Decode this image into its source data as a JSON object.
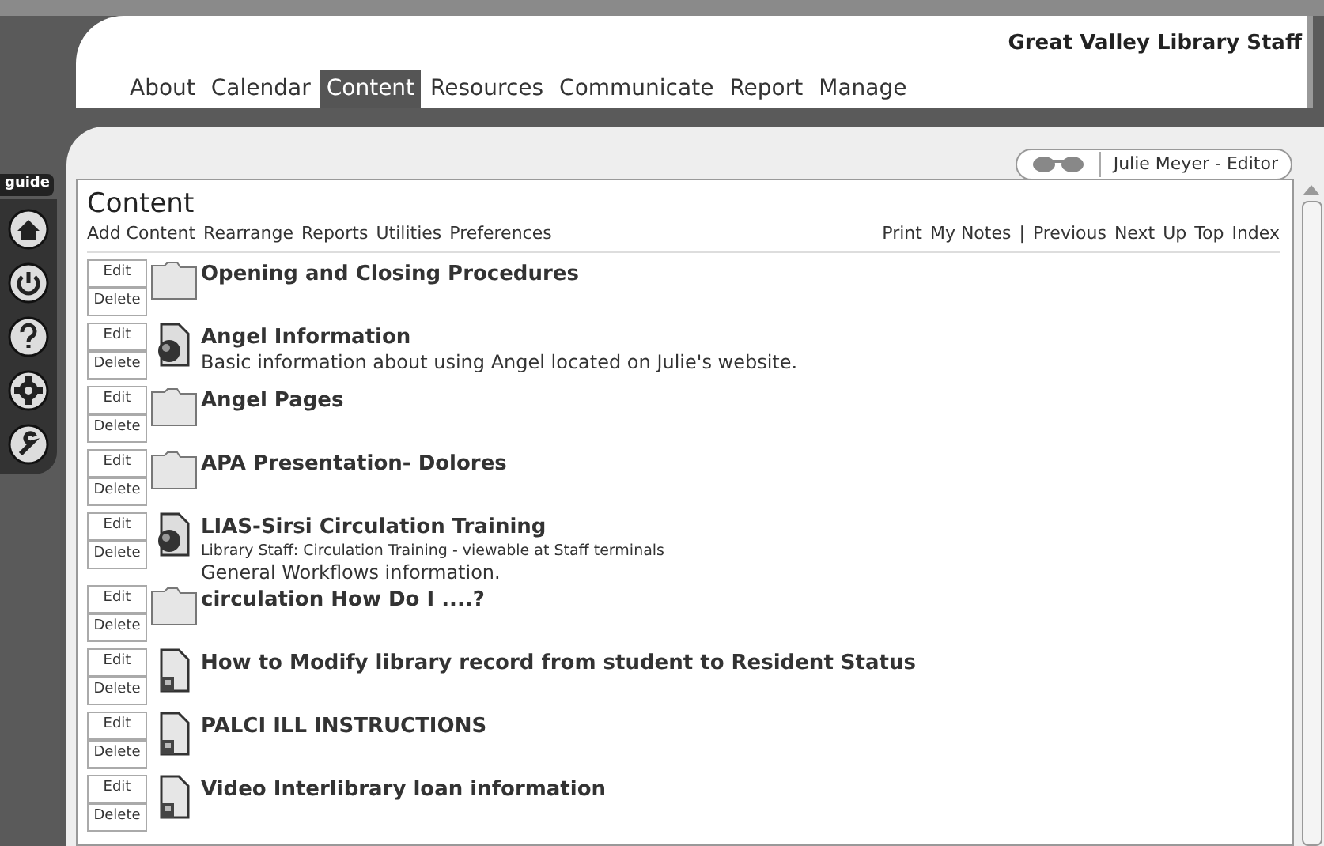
{
  "site_title": "Great Valley Library Staff",
  "tabs": [
    {
      "label": "About",
      "selected": false
    },
    {
      "label": "Calendar",
      "selected": false
    },
    {
      "label": "Content",
      "selected": true
    },
    {
      "label": "Resources",
      "selected": false
    },
    {
      "label": "Communicate",
      "selected": false
    },
    {
      "label": "Report",
      "selected": false
    },
    {
      "label": "Manage",
      "selected": false
    }
  ],
  "guide_label": "guide",
  "user": "Julie Meyer - Editor",
  "page_title": "Content",
  "actions": [
    "Add Content",
    "Rearrange",
    "Reports",
    "Utilities",
    "Preferences"
  ],
  "page_links": [
    "Print",
    "My Notes"
  ],
  "link_separator": "|",
  "nav_links": [
    "Previous",
    "Next",
    "Up",
    "Top",
    "Index"
  ],
  "items": [
    {
      "kind": "folder",
      "title": "Opening and Closing Procedures",
      "edit": "Edit",
      "delete": "Delete"
    },
    {
      "kind": "web",
      "title": "Angel Information",
      "edit": "Edit",
      "delete": "Delete",
      "notes": [
        {
          "kind": "normal",
          "text": "Basic information about using Angel located on Julie's website."
        }
      ]
    },
    {
      "kind": "folder",
      "title": "Angel Pages",
      "edit": "Edit",
      "delete": "Delete"
    },
    {
      "kind": "folder",
      "title": "APA Presentation- Dolores",
      "edit": "Edit",
      "delete": "Delete"
    },
    {
      "kind": "web",
      "title": "LIAS-Sirsi Circulation Training",
      "edit": "Edit",
      "delete": "Delete",
      "notes": [
        {
          "kind": "small",
          "text": "Library Staff: Circulation Training - viewable at Staff terminals"
        },
        {
          "kind": "normal",
          "text": "General Workflows information."
        }
      ]
    },
    {
      "kind": "folder",
      "title": "circulation How Do I ....?",
      "edit": "Edit",
      "delete": "Delete"
    },
    {
      "kind": "document",
      "title": "How to Modify library record from student to Resident Status",
      "edit": "Edit",
      "delete": "Delete"
    },
    {
      "kind": "document",
      "title": "PALCI ILL INSTRUCTIONS",
      "edit": "Edit",
      "delete": "Delete"
    },
    {
      "kind": "document",
      "title": "Video Interlibrary loan information",
      "edit": "Edit",
      "delete": "Delete"
    }
  ]
}
